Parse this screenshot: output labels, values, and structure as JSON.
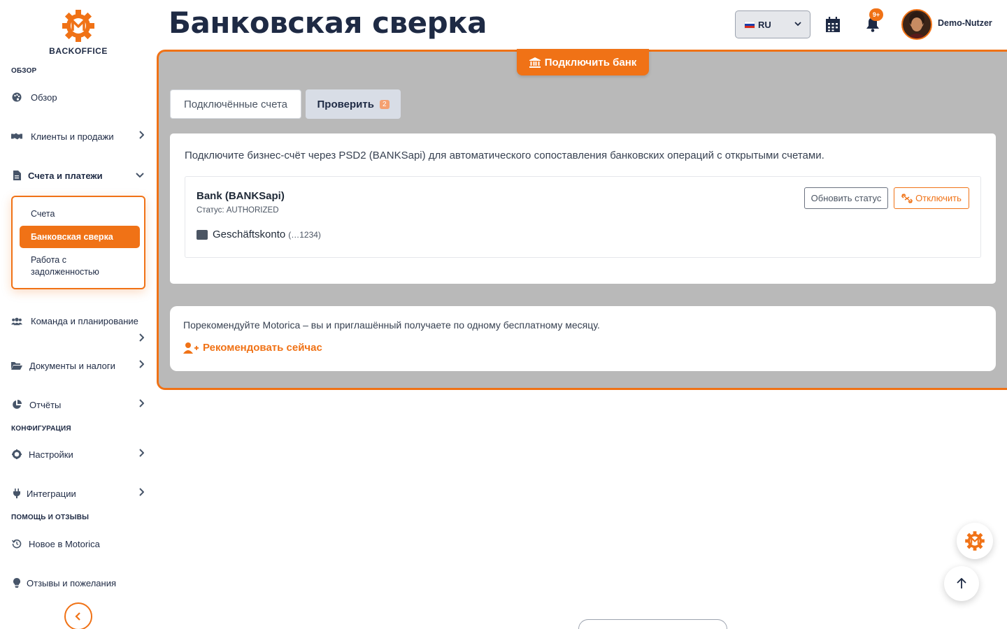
{
  "app": {
    "logo_text": "BACKOFFICE",
    "brand_color": "#f07216",
    "navy_color": "#1e2a44"
  },
  "sidebar": {
    "section_overview": "ОБЗОР",
    "section_config": "КОНФИГУРАЦИЯ",
    "section_help": "ПОМОЩЬ И ОТЗЫВЫ",
    "items": {
      "overview": "Обзор",
      "clients": "Клиенты и продажи",
      "invoices": "Счета и платежи",
      "team": "Команда и планирование",
      "documents": "Документы и налоги",
      "reports": "Отчёты",
      "settings": "Настройки",
      "integrations": "Интеграции",
      "whats_new": "Новое в Motorica",
      "feedback": "Отзывы и пожелания"
    },
    "subitems": {
      "invoices": "Счета",
      "bank_reconciliation": "Банковская сверка",
      "dunning": "Работа с задолженностью"
    }
  },
  "header": {
    "title": "Банковская сверка",
    "language": "RU",
    "notifications_badge": "9+",
    "user_name": "Demo-Nutzer"
  },
  "main": {
    "connect_bank_label": "Подключить банк",
    "tabs": {
      "connected": "Подключённые счета",
      "review": "Проверить",
      "review_count": "2"
    },
    "intro": "Подключите бизнес-счёт через PSD2 (BANKSapi) для автоматического сопоставления банковских операций с открытыми счетами.",
    "bank": {
      "name": "Bank (BANKSapi)",
      "status": "Статус: AUTHORIZED",
      "refresh_label": "Обновить статус",
      "disconnect_label": "Отключить",
      "account_name": "Geschäftskonto",
      "account_number": "(…1234)"
    },
    "referral": {
      "text": "Порекомендуйте Motorica – вы и приглашённый получаете по одному бесплатному месяцу.",
      "link": "Рекомендовать сейчас"
    }
  }
}
